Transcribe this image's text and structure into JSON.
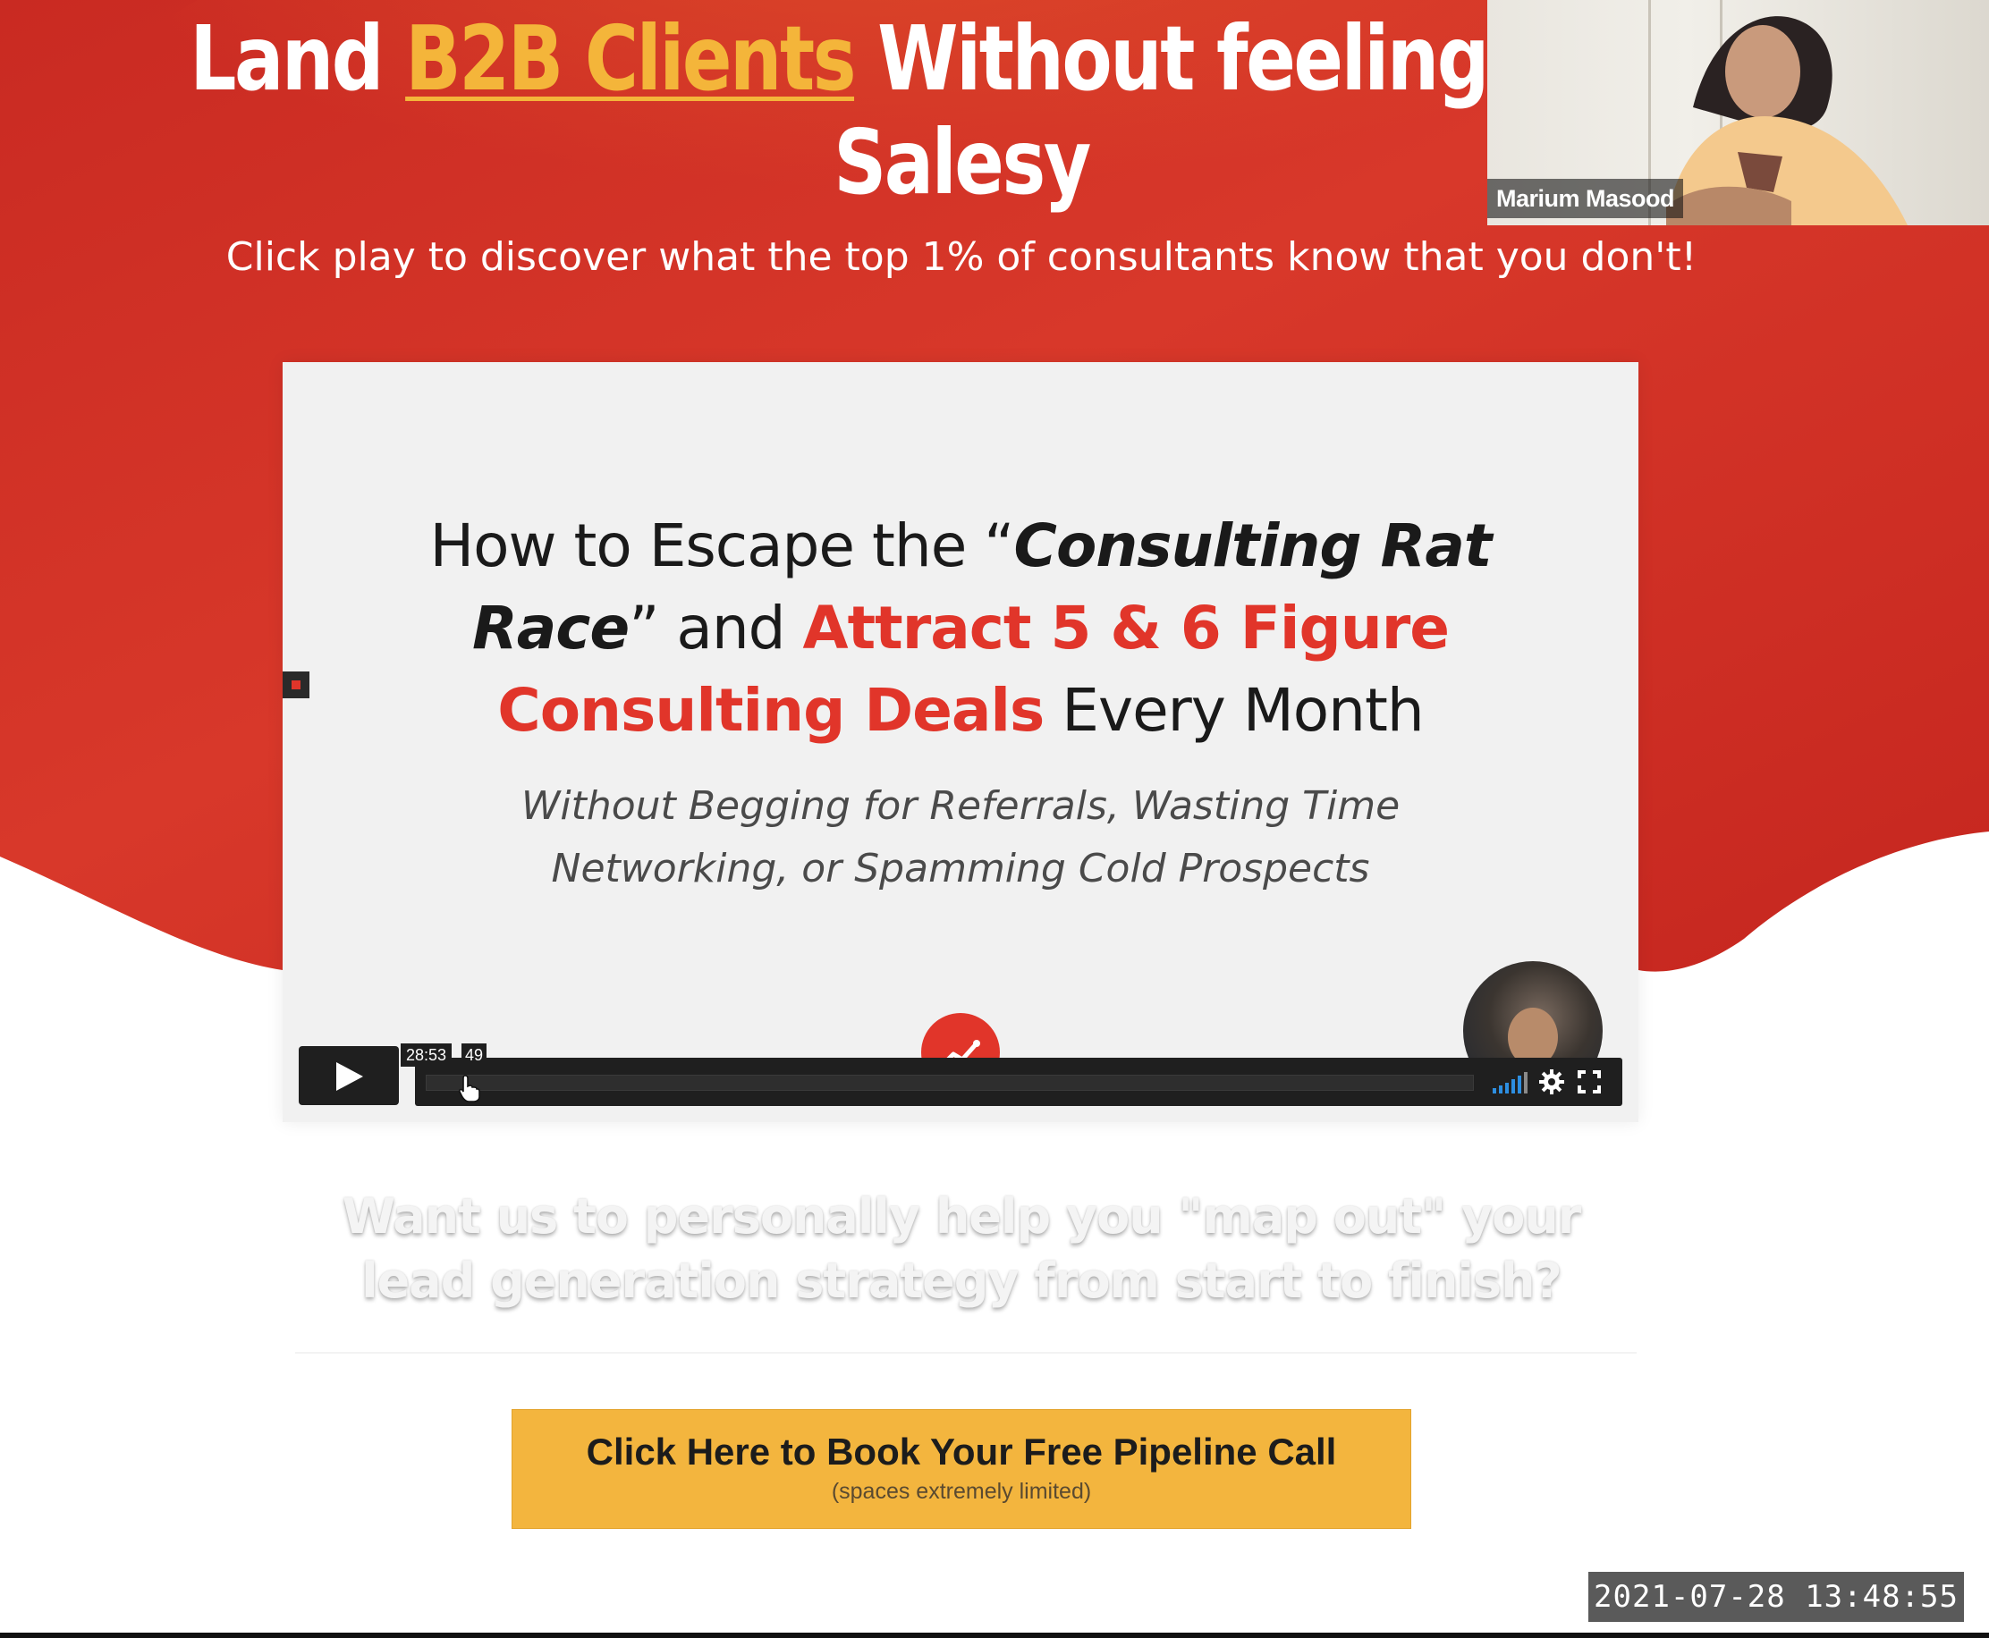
{
  "hero": {
    "headline_part1": "Land ",
    "headline_highlight": "B2B Clients",
    "headline_part2": " Without feeling Spam",
    "headline_line2": "Salesy",
    "subheadline": "Click play to discover what the top 1% of consultants know that you don't!"
  },
  "webcam": {
    "participant_name": "Marium Masood"
  },
  "video": {
    "title_lead": "How to Escape the “",
    "title_italic_1": "Consulting Rat",
    "title_italic_2": "Race",
    "title_after_quote": "” and ",
    "title_red_1": "Attract 5 & 6 Figure",
    "title_red_2": "Consulting Deals",
    "title_end": " Every Month",
    "subtitle_line1": "Without Begging for Referrals, Wasting Time",
    "subtitle_line2": "Networking, or Spamming Cold Prospects",
    "hover_time": "28:53",
    "hover_time_2": "49"
  },
  "cta": {
    "question_line1": "Want us to personally help you \"map out\" your",
    "question_line2": "lead generation strategy from start to finish?",
    "button_label": "Click Here to Book Your Free Pipeline Call",
    "button_sublabel": "(spaces extremely limited)"
  },
  "overlay": {
    "timestamp": "2021-07-28 13:48:55"
  },
  "colors": {
    "hero_red": "#d8362a",
    "highlight_gold": "#f4b53a",
    "slide_red": "#e1352a",
    "cta_yellow": "#f3b53e"
  },
  "icons": [
    "play-icon",
    "cursor-icon",
    "volume-icon",
    "gear-icon",
    "fullscreen-icon",
    "chart-logo-icon"
  ]
}
